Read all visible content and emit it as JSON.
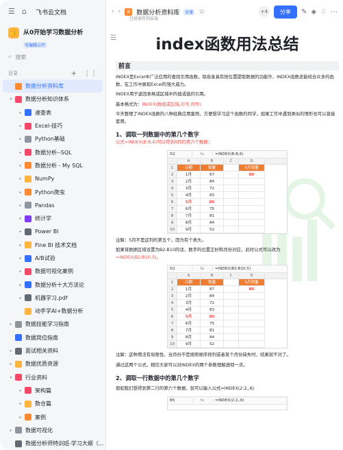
{
  "app": {
    "name": "飞书云文档"
  },
  "space": {
    "name": "从0开始学习数据分析",
    "badge": "可编辑公开"
  },
  "search": {
    "placeholder": "搜索"
  },
  "directory": {
    "label": "目录",
    "add": "+",
    "more": "⋮⋮"
  },
  "sidebar_items": [
    {
      "label": "数据分析资料库",
      "level": 0,
      "arrow": "",
      "icon_color": "#ff8a34",
      "active": true
    },
    {
      "label": "数据分析知识体系",
      "level": 0,
      "arrow": "▾",
      "icon_color": "#f5496a"
    },
    {
      "label": "速查表",
      "level": 1,
      "arrow": "▸",
      "icon_color": "#3370ff"
    },
    {
      "label": "Excel-技巧",
      "level": 1,
      "arrow": "▸",
      "icon_color": "#f5496a"
    },
    {
      "label": "Python基础",
      "level": 1,
      "arrow": "▸",
      "icon_color": "#8f959e"
    },
    {
      "label": "数据分析--SQL",
      "level": 1,
      "arrow": "▸",
      "icon_color": "#f5496a"
    },
    {
      "label": "数据分析 - My SQL",
      "level": 1,
      "arrow": "▸",
      "icon_color": "#ff8a34"
    },
    {
      "label": "NumPy",
      "level": 1,
      "arrow": "▸",
      "icon_color": "#ffb43f"
    },
    {
      "label": "Python爬虫",
      "level": 1,
      "arrow": "▸",
      "icon_color": "#ff8a34"
    },
    {
      "label": "Pandas",
      "level": 1,
      "arrow": "▸",
      "icon_color": "#8f959e"
    },
    {
      "label": "统计学",
      "level": 1,
      "arrow": "▸",
      "icon_color": "#7f3bf5"
    },
    {
      "label": "Power BI",
      "level": 1,
      "arrow": "▸",
      "icon_color": "#646a73"
    },
    {
      "label": "Fine BI 技术文档",
      "level": 1,
      "arrow": "▸",
      "icon_color": "#ffb43f"
    },
    {
      "label": "A/B试验",
      "level": 1,
      "arrow": "▸",
      "icon_color": "#3370ff"
    },
    {
      "label": "数据可视化案例",
      "level": 1,
      "arrow": "▸",
      "icon_color": "#f5496a"
    },
    {
      "label": "数据分析十大方法论",
      "level": 1,
      "arrow": "▸",
      "icon_color": "#3370ff"
    },
    {
      "label": "机器学习.pdf",
      "level": 1,
      "arrow": "▸",
      "icon_color": "#646a73"
    },
    {
      "label": "动手学AI+数据分析",
      "level": 1,
      "arrow": "",
      "icon_color": "#ffb43f"
    },
    {
      "label": "数据技能学习指南",
      "level": 0,
      "arrow": "▸",
      "icon_color": "#8f959e"
    },
    {
      "label": "数据岗位指南",
      "level": 0,
      "arrow": "",
      "icon_color": "#3370ff"
    },
    {
      "label": "面试相关资料",
      "level": 0,
      "arrow": "▸",
      "icon_color": "#646a73"
    },
    {
      "label": "数据优质资源",
      "level": 0,
      "arrow": "▸",
      "icon_color": "#ffb43f"
    },
    {
      "label": "行业资料",
      "level": 0,
      "arrow": "▾",
      "icon_color": "#f5496a"
    },
    {
      "label": "架构篇",
      "level": 1,
      "arrow": "▸",
      "icon_color": "#f5496a"
    },
    {
      "label": "数仓篇",
      "level": 1,
      "arrow": "▸",
      "icon_color": "#ffb43f"
    },
    {
      "label": "案例",
      "level": 1,
      "arrow": "▸",
      "icon_color": "#ff8a34"
    },
    {
      "label": "数据可视化",
      "level": 0,
      "arrow": "▸",
      "icon_color": "#8f959e"
    },
    {
      "label": "数据分析师特训班-学习大纲（...",
      "level": 0,
      "arrow": "",
      "icon_color": "#646a73"
    }
  ],
  "topbar": {
    "back": "‹",
    "forward": "›",
    "doc_title": "数据分析资料库",
    "tag": "分享",
    "saved": "已经保存到云端",
    "collab_count": "+4",
    "share_label": "分享"
  },
  "doc": {
    "title": "index函数用法总结",
    "preface_heading": "前言",
    "p1": "INDEX是Excel中广泛应用的查找引用函数，除自身具有按位置提取数据的功能外，INDEX函数还能结合众多的函数，在工作中展现Excel的强大威力。",
    "p2": "INDEX用于返回表格或区域中的值或值的引用。",
    "p3_prefix": "基本格式为：",
    "p3_red": "INDEX(数组或区域,行号,列号)",
    "p4": "今天整理了INDEX函数的八种经典应用案例，方便想学习这个函数的同学，如果工作中遇到类似的情形也可以直接套用。",
    "h2_1": "1、调取一列数据中的第几个数字",
    "formula_1": "公式=INDEX(B:B,6)可以得到B列的第六个数据；",
    "note_1": "注解：5月不是这列的第五个，因为有个表头。",
    "p5": "如果将数据区域设置为B2:B10的话，数字的位置正好和月份对应，此时公式可以改为",
    "formula_2": "=INDEX(B2:B10,5)。",
    "note_2": "注解：这种用法有局限性，当月份不是按照顺序排列或者某个月份缺失时，结果就不对了。",
    "p6": "通过这两个公式，相信大家可以对INDEX的两个参数理解透彻一点。",
    "h2_2": "2、调取一行数据中的第几个数字",
    "p7": "假如我们想得到第二行的第六个数据，就可以输入公式=INDEX(2:2,,6)"
  },
  "sheet1": {
    "cell_ref": "D2",
    "fx": "fx",
    "formula": "=INDEX(B:B,6)",
    "cols": [
      "",
      "A",
      "B",
      "C",
      "D"
    ],
    "rows": [
      {
        "n": "1",
        "a": "日期",
        "b": "销量",
        "d": "5月销量"
      },
      {
        "n": "2",
        "a": "1月",
        "b": "67",
        "d": "85"
      },
      {
        "n": "3",
        "a": "2月",
        "b": "84",
        "d": ""
      },
      {
        "n": "4",
        "a": "3月",
        "b": "72",
        "d": ""
      },
      {
        "n": "5",
        "a": "4月",
        "b": "83",
        "d": ""
      },
      {
        "n": "6",
        "a": "5月",
        "b": "85",
        "d": ""
      },
      {
        "n": "7",
        "a": "6月",
        "b": "75",
        "d": ""
      },
      {
        "n": "8",
        "a": "7月",
        "b": "81",
        "d": ""
      },
      {
        "n": "9",
        "a": "8月",
        "b": "84",
        "d": ""
      },
      {
        "n": "10",
        "a": "9月",
        "b": "52",
        "d": ""
      }
    ]
  },
  "sheet2": {
    "cell_ref": "D2",
    "fx": "fx",
    "formula": "=INDEX(B2:B10,5)",
    "cols": [
      "",
      "A",
      "B",
      "C",
      "D"
    ],
    "rows": [
      {
        "n": "1",
        "a": "日期",
        "b": "销量",
        "d": "5月销量"
      },
      {
        "n": "2",
        "a": "1月",
        "b": "67",
        "d": "85"
      },
      {
        "n": "3",
        "a": "2月",
        "b": "84",
        "d": ""
      },
      {
        "n": "4",
        "a": "3月",
        "b": "72",
        "d": ""
      },
      {
        "n": "5",
        "a": "4月",
        "b": "83",
        "d": ""
      },
      {
        "n": "6",
        "a": "5月",
        "b": "85",
        "d": ""
      },
      {
        "n": "7",
        "a": "6月",
        "b": "75",
        "d": ""
      },
      {
        "n": "8",
        "a": "7月",
        "b": "81",
        "d": ""
      },
      {
        "n": "9",
        "a": "8月",
        "b": "84",
        "d": ""
      },
      {
        "n": "10",
        "a": "9月",
        "b": "52",
        "d": ""
      }
    ]
  },
  "sheet3": {
    "cell_ref": "B5",
    "fx": "fx",
    "formula": "=INDEX(2:2,,6)"
  }
}
